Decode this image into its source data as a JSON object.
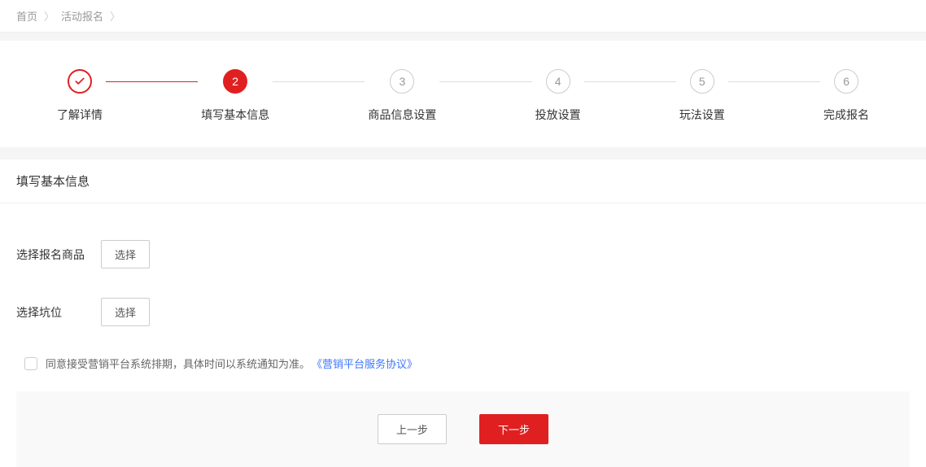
{
  "breadcrumb": {
    "items": [
      "首页",
      "活动报名"
    ],
    "separator": "〉"
  },
  "steps": [
    {
      "label": "了解详情",
      "state": "completed"
    },
    {
      "label": "填写基本信息",
      "state": "current",
      "number": "2"
    },
    {
      "label": "商品信息设置",
      "state": "pending",
      "number": "3"
    },
    {
      "label": "投放设置",
      "state": "pending",
      "number": "4"
    },
    {
      "label": "玩法设置",
      "state": "pending",
      "number": "5"
    },
    {
      "label": "完成报名",
      "state": "pending",
      "number": "6"
    }
  ],
  "section": {
    "title": "填写基本信息"
  },
  "form": {
    "product_label": "选择报名商品",
    "product_button": "选择",
    "slot_label": "选择坑位",
    "slot_button": "选择",
    "agreement_text": "同意接受营销平台系统排期，具体时间以系统通知为准。",
    "agreement_link": "《营销平台服务协议》"
  },
  "footer": {
    "prev": "上一步",
    "next": "下一步"
  }
}
